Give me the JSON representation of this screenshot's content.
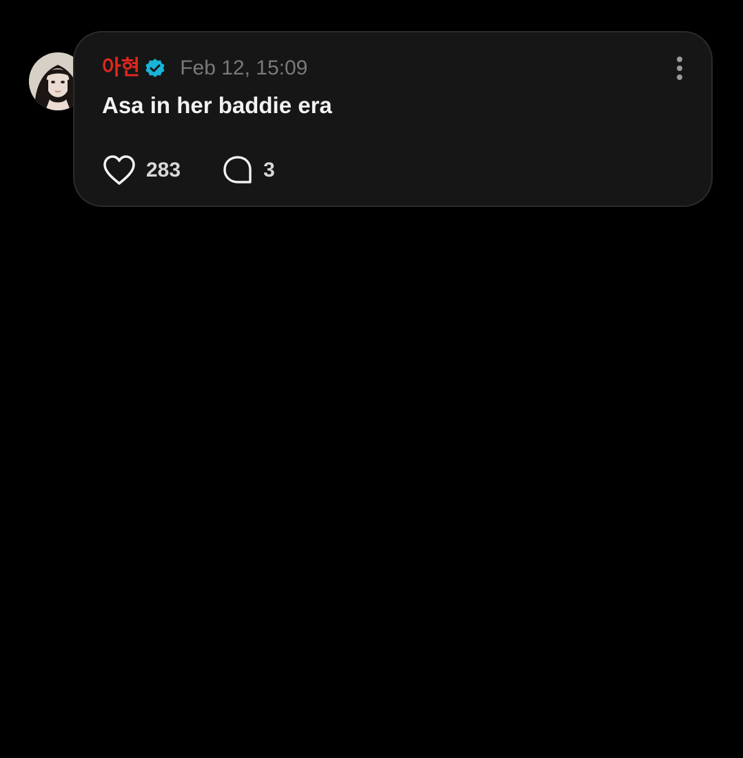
{
  "post": {
    "author": "아현",
    "verified": true,
    "timestamp": "Feb 12, 15:09",
    "text": "Asa in her baddie era",
    "likes": "283",
    "comments": "3"
  },
  "colors": {
    "author_name": "#e0281e",
    "verified_badge": "#19b5d8",
    "card_background": "#161616",
    "page_background": "#000000"
  },
  "icons": {
    "verified": "verified-badge-icon",
    "more": "more-vertical-icon",
    "like": "heart-outline-icon",
    "comment": "speech-bubble-outline-icon"
  }
}
